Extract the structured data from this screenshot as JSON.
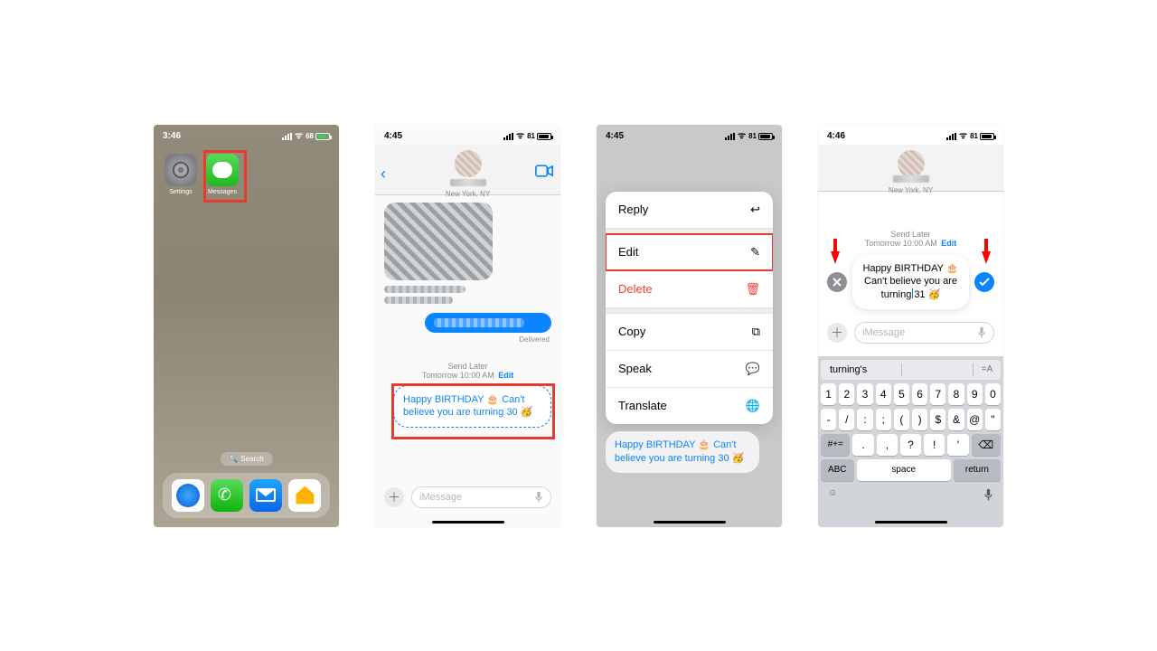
{
  "status": {
    "time_home": "3:46",
    "time_msg": "4:45",
    "time_msg2": "4:46",
    "battery_home": "68",
    "battery_msg": "81"
  },
  "home": {
    "app_settings": "Settings",
    "app_messages": "Messages",
    "search": "Search"
  },
  "conv": {
    "location": "New York, NY",
    "delivered": "Delivered",
    "send_later_title": "Send Later",
    "send_later_time": "Tomorrow 10:00 AM",
    "send_later_edit": "Edit",
    "scheduled_msg_30": "Happy BIRTHDAY 🎂 Can't believe you are turning 30 🥳",
    "scheduled_msg_31": "Happy BIRTHDAY 🎂 Can't believe you are turning 31 🥳",
    "imsg_placeholder": "iMessage"
  },
  "menu": {
    "reply": "Reply",
    "edit": "Edit",
    "delete": "Delete",
    "copy": "Copy",
    "speak": "Speak",
    "translate": "Translate"
  },
  "kb": {
    "suggestion": "turning's",
    "row1": [
      "1",
      "2",
      "3",
      "4",
      "5",
      "6",
      "7",
      "8",
      "9",
      "0"
    ],
    "row2": [
      "-",
      "/",
      ":",
      ";",
      "(",
      ")",
      "$",
      "&",
      "@",
      "\""
    ],
    "shift": "#+=",
    "row3": [
      ".",
      ",",
      "?",
      "!",
      "'"
    ],
    "abc": "ABC",
    "space": "space",
    "ret": "return",
    "eqA": "=A"
  }
}
